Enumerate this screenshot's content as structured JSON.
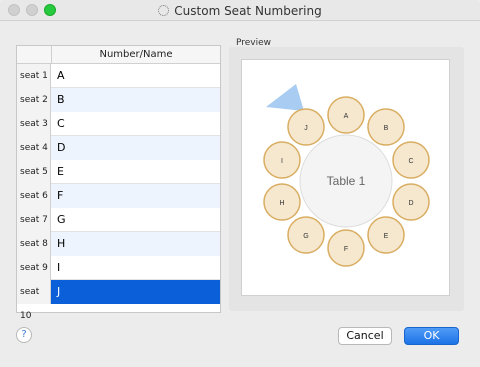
{
  "window": {
    "title": "Custom Seat Numbering",
    "title_icon": "dotted-circle-icon"
  },
  "table": {
    "header": "Number/Name",
    "rows": [
      {
        "seat": "seat 1",
        "name": "A"
      },
      {
        "seat": "seat 2",
        "name": "B"
      },
      {
        "seat": "seat 3",
        "name": "C"
      },
      {
        "seat": "seat 4",
        "name": "D"
      },
      {
        "seat": "seat 5",
        "name": "E"
      },
      {
        "seat": "seat 6",
        "name": "F"
      },
      {
        "seat": "seat 7",
        "name": "G"
      },
      {
        "seat": "seat 8",
        "name": "H"
      },
      {
        "seat": "seat 9",
        "name": "I"
      },
      {
        "seat": "seat 10",
        "name": "J"
      }
    ],
    "selected_seat": "seat 10"
  },
  "preview": {
    "label": "Preview",
    "table_label": "Table 1",
    "seats": [
      "A",
      "B",
      "C",
      "D",
      "E",
      "F",
      "G",
      "H",
      "I",
      "J"
    ],
    "colors": {
      "seat_fill": "#f5e8cf",
      "seat_stroke": "#d9ad62",
      "table_fill": "#f4f4f4",
      "marker": "#a8ccf2"
    }
  },
  "buttons": {
    "help": "?",
    "cancel": "Cancel",
    "ok": "OK"
  }
}
